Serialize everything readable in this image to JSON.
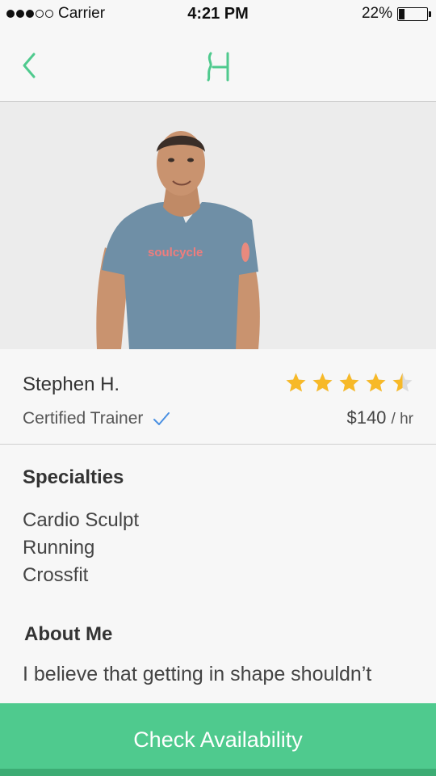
{
  "status_bar": {
    "carrier": "Carrier",
    "time": "4:21 PM",
    "battery_percent_text": "22%",
    "battery_level": 0.22,
    "signal_bars_filled": 3,
    "signal_bars_total": 5
  },
  "nav": {
    "back_icon": "chevron-left-icon",
    "logo_icon": "brand-logo-icon",
    "accent_color": "#4fca8e"
  },
  "trainer": {
    "name": "Stephen H.",
    "title": "Certified Trainer",
    "verified": true,
    "rating": 4.5,
    "rating_max": 5,
    "star_color": "#f7b928",
    "price": "$140",
    "price_unit": "/ hr",
    "shirt_text": "soulcycle"
  },
  "specialties": {
    "title": "Specialties",
    "items": [
      "Cardio Sculpt",
      "Running",
      "Crossfit"
    ]
  },
  "about": {
    "title": "About Me",
    "text": "I believe that getting in shape shouldn’t"
  },
  "cta": {
    "label": "Check Availability",
    "color": "#4fca8e"
  }
}
